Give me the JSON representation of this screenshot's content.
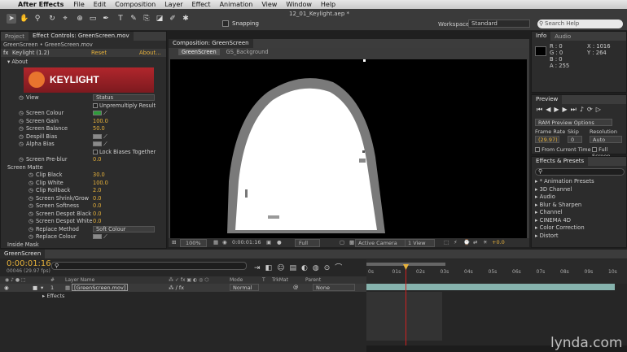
{
  "menubar": {
    "app": "After Effects",
    "items": [
      "File",
      "Edit",
      "Composition",
      "Layer",
      "Effect",
      "Animation",
      "View",
      "Window",
      "Help"
    ]
  },
  "window_title": "12_01_Keylight.aep *",
  "toolbar": {
    "snapping_label": "Snapping",
    "workspace_label": "Workspace:",
    "workspace_value": "Standard",
    "search_placeholder": "Search Help"
  },
  "left_panel": {
    "tabs": [
      "Project",
      "Effect Controls: GreenScreen.mov"
    ],
    "breadcrumb": "GreenScreen • GreenScreen.mov",
    "effect_name": "Keylight (1.2)",
    "reset": "Reset",
    "about": "About...",
    "about_group": "About",
    "logo_text": "KEYLIGHT",
    "rows": [
      {
        "label": "View",
        "value": "Status",
        "kind": "dropdown"
      },
      {
        "label": "",
        "value": "Unpremultiply Result",
        "kind": "checkbox"
      },
      {
        "label": "Screen Colour",
        "value": "",
        "kind": "color-green"
      },
      {
        "label": "Screen Gain",
        "value": "100.0",
        "kind": "number"
      },
      {
        "label": "Screen Balance",
        "value": "50.0",
        "kind": "number"
      },
      {
        "label": "Despill Bias",
        "value": "",
        "kind": "color-gray"
      },
      {
        "label": "Alpha Bias",
        "value": "",
        "kind": "color-gray"
      },
      {
        "label": "",
        "value": "Lock Biases Together",
        "kind": "checkbox"
      },
      {
        "label": "Screen Pre-blur",
        "value": "0.0",
        "kind": "number"
      },
      {
        "label": "Screen Matte",
        "value": "",
        "kind": "group"
      },
      {
        "label": "Clip Black",
        "value": "30.0",
        "kind": "number"
      },
      {
        "label": "Clip White",
        "value": "100.0",
        "kind": "number"
      },
      {
        "label": "Clip Rollback",
        "value": "2.0",
        "kind": "number"
      },
      {
        "label": "Screen Shrink/Grow",
        "value": "0.0",
        "kind": "number"
      },
      {
        "label": "Screen Softness",
        "value": "0.0",
        "kind": "number"
      },
      {
        "label": "Screen Despot Black",
        "value": "0.0",
        "kind": "number"
      },
      {
        "label": "Screen Despot White",
        "value": "0.0",
        "kind": "number"
      },
      {
        "label": "Replace Method",
        "value": "Soft Colour",
        "kind": "dropdown"
      },
      {
        "label": "Replace Colour",
        "value": "",
        "kind": "color-gray"
      },
      {
        "label": "Inside Mask",
        "value": "",
        "kind": "group"
      }
    ]
  },
  "viewer": {
    "tab": "Composition: GreenScreen",
    "sub_tabs": [
      "GreenScreen",
      "GS_Background"
    ],
    "zoom": "100%",
    "timecode": "0:00:01:16",
    "resolution": "Full",
    "camera": "Active Camera",
    "views": "1 View",
    "exposure": "+0.0"
  },
  "info_panel": {
    "tabs": [
      "Info",
      "Audio"
    ],
    "r": "R : 0",
    "g": "G : 0",
    "b": "B : 0",
    "a": "A : 255",
    "x": "X : 1016",
    "y": "Y : 264"
  },
  "preview_panel": {
    "title": "Preview",
    "ram_label": "RAM Preview Options",
    "frame_rate_label": "Frame Rate",
    "skip_label": "Skip",
    "resolution_label": "Resolution",
    "frame_rate": "(29.97)",
    "skip": "0",
    "resolution": "Auto",
    "from_current": "From Current Time",
    "full_screen": "Full Screen"
  },
  "effects_panel": {
    "title": "Effects & Presets",
    "search_placeholder": "",
    "items": [
      "* Animation Presets",
      "3D Channel",
      "Audio",
      "Blur & Sharpen",
      "Channel",
      "CINEMA 4D",
      "Color Correction",
      "Distort"
    ]
  },
  "timeline": {
    "tab": "GreenScreen",
    "timecode": "0:00:01:16",
    "frame_info": "00046 (29.97 fps)",
    "search_placeholder": "",
    "columns": {
      "layer_name": "Layer Name",
      "mode": "Mode",
      "t": "T",
      "trkmat": "TrkMat",
      "parent": "Parent"
    },
    "layer": {
      "index": "1",
      "name": "[GreenScreen.mov]",
      "mode": "Normal",
      "parent": "None"
    },
    "effects_label": "Effects",
    "ruler": [
      "0s",
      "01s",
      "02s",
      "03s",
      "04s",
      "05s",
      "06s",
      "07s",
      "08s",
      "09s",
      "10s"
    ]
  },
  "watermark": "lynda.com"
}
